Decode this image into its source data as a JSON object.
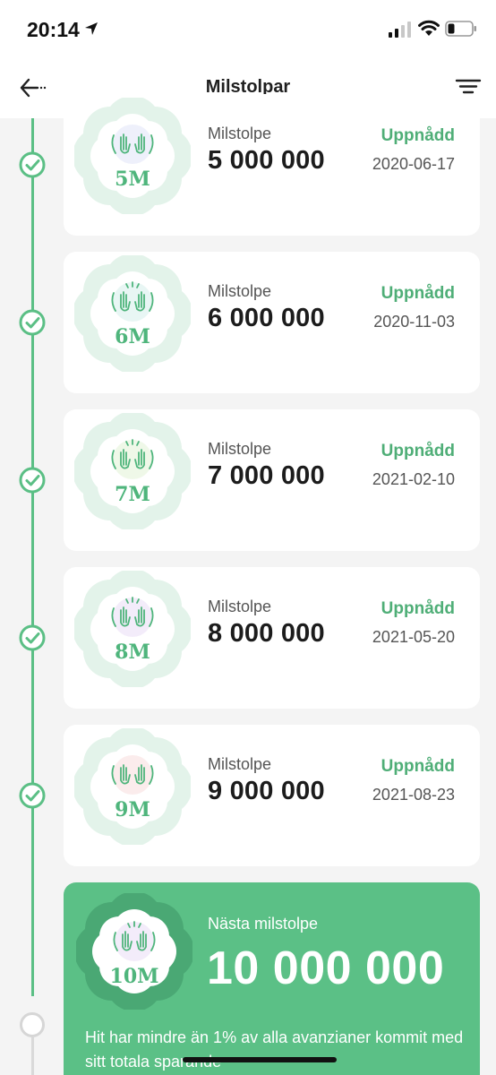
{
  "status_bar": {
    "time": "20:14",
    "icons": [
      "location-arrow-icon",
      "cellular-signal-icon",
      "wifi-icon",
      "battery-icon"
    ]
  },
  "nav": {
    "back_icon": "back-arrow-icon",
    "title": "Milstolpar",
    "filter_icon": "filter-icon"
  },
  "colors": {
    "accent": "#5bc086",
    "accent_dark": "#4fae77",
    "timeline_done": "#5bbf85",
    "timeline_pending": "#d9d9d9",
    "card_bg": "#ffffff",
    "page_bg": "#f4f4f4"
  },
  "milestones": [
    {
      "badge": "5M",
      "caption": "Milstolpe",
      "amount": "5 000 000",
      "status": "Uppnådd",
      "date": "2020-06-17"
    },
    {
      "badge": "6M",
      "caption": "Milstolpe",
      "amount": "6 000 000",
      "status": "Uppnådd",
      "date": "2020-11-03"
    },
    {
      "badge": "7M",
      "caption": "Milstolpe",
      "amount": "7 000 000",
      "status": "Uppnådd",
      "date": "2021-02-10"
    },
    {
      "badge": "8M",
      "caption": "Milstolpe",
      "amount": "8 000 000",
      "status": "Uppnådd",
      "date": "2021-05-20"
    },
    {
      "badge": "9M",
      "caption": "Milstolpe",
      "amount": "9 000 000",
      "status": "Uppnådd",
      "date": "2021-08-23"
    }
  ],
  "next": {
    "badge": "10M",
    "caption": "Nästa milstolpe",
    "amount": "10 000 000",
    "description": "Hit har mindre än 1% av alla avanzianer kommit med sitt totala sparande"
  }
}
